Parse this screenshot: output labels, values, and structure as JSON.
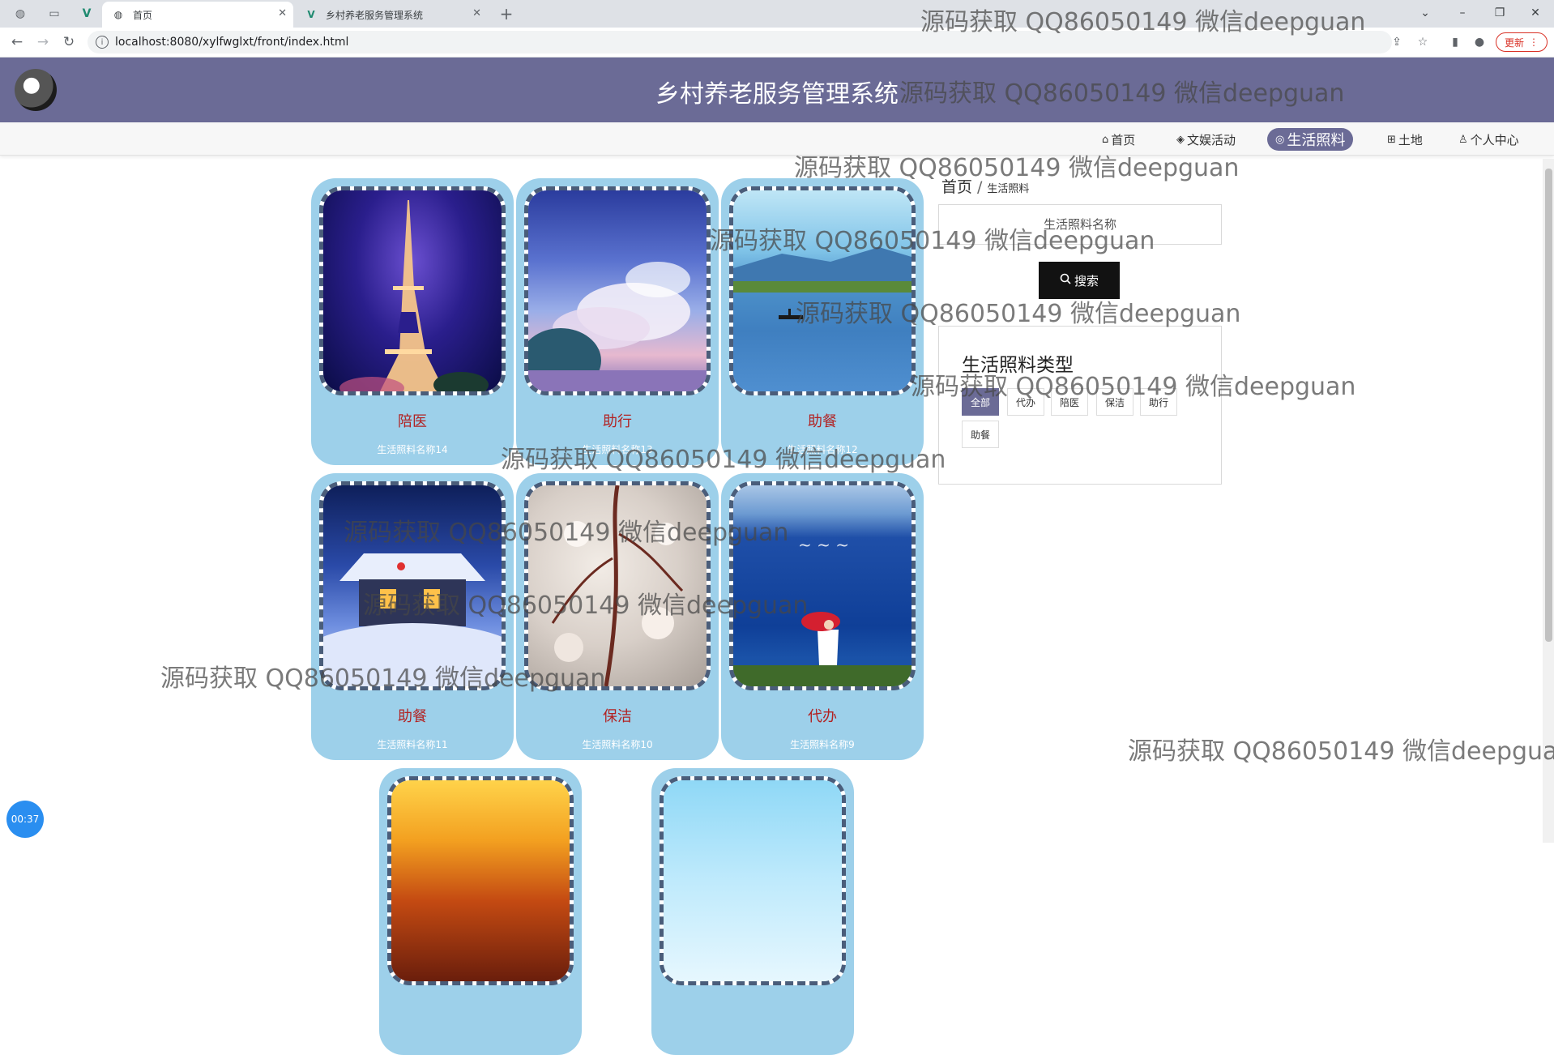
{
  "browser": {
    "tabs": [
      {
        "title": "首页",
        "active": true
      },
      {
        "title": "乡村养老服务管理系统",
        "active": false
      }
    ],
    "new_tab_label": "+",
    "address": "localhost:8080/xylfwglxt/front/index.html",
    "update_label": "更新"
  },
  "site": {
    "title": "乡村养老服务管理系统"
  },
  "nav": {
    "items": [
      {
        "icon": "⌂",
        "label": "首页"
      },
      {
        "icon": "◈",
        "label": "文娱活动"
      },
      {
        "icon": "◎",
        "label": "生活照料",
        "active": true
      },
      {
        "icon": "⊞",
        "label": "土地"
      },
      {
        "icon": "♙",
        "label": "个人中心"
      }
    ]
  },
  "cards": [
    {
      "name": "陪医",
      "subtitle": "生活照料名称14",
      "image": "eiffel-tower-night"
    },
    {
      "name": "助行",
      "subtitle": "生活照料名称13",
      "image": "clouds-sky"
    },
    {
      "name": "助餐",
      "subtitle": "生活照料名称12",
      "image": "lake-boat"
    },
    {
      "name": "助餐",
      "subtitle": "生活照料名称11",
      "image": "snowy-cabin"
    },
    {
      "name": "保洁",
      "subtitle": "生活照料名称10",
      "image": "blossom-branch"
    },
    {
      "name": "代办",
      "subtitle": "生活照料名称9",
      "image": "sea-umbrella"
    },
    {
      "name": "",
      "subtitle": "",
      "image": "sunset-clouds"
    },
    {
      "name": "",
      "subtitle": "",
      "image": "blue-sky"
    }
  ],
  "breadcrumb": {
    "home": "首页",
    "separator": "/",
    "current": "生活照料"
  },
  "search": {
    "placeholder": "生活照料名称",
    "button_label": "搜索"
  },
  "types": {
    "title": "生活照料类型",
    "items": [
      "全部",
      "代办",
      "陪医",
      "保洁",
      "助行",
      "助餐"
    ],
    "active": "全部"
  },
  "timer": "00:37",
  "watermark": "源码获取 QQ86050149 微信deepguan",
  "colors": {
    "header": "#6b6b96",
    "card": "#9dd0ea",
    "card_title": "#b22222"
  }
}
